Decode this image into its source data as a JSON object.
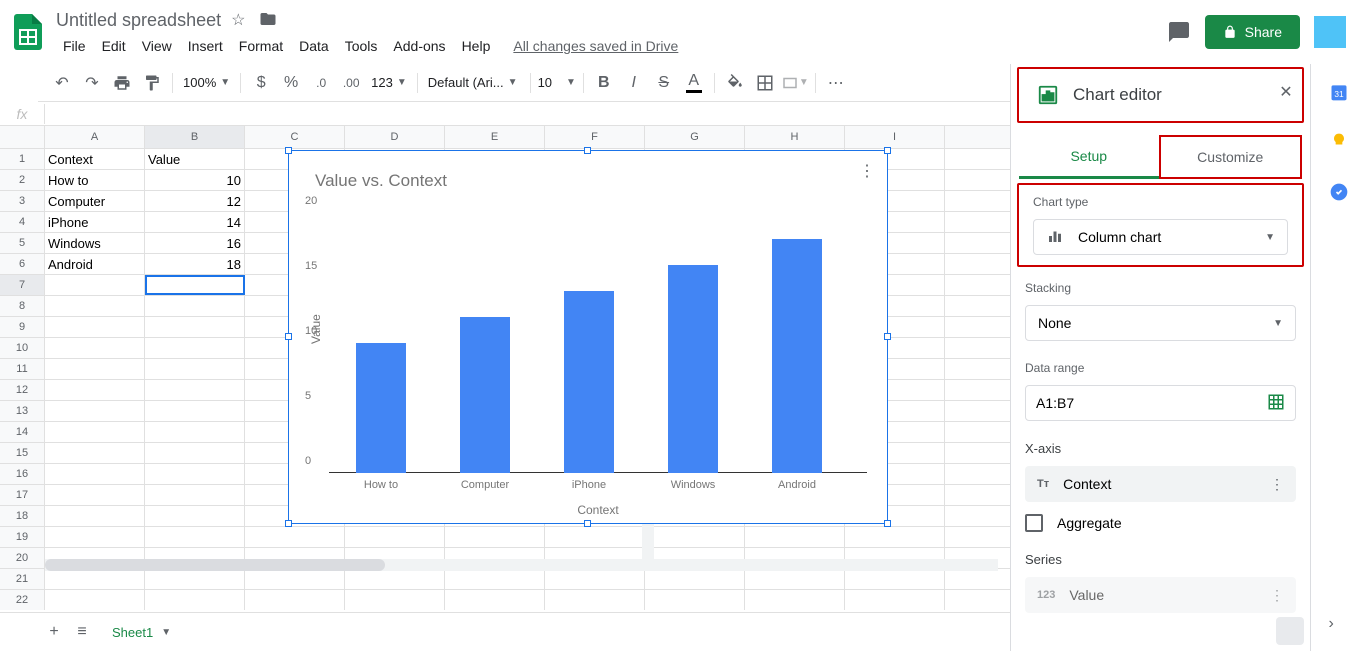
{
  "header": {
    "doc_title": "Untitled spreadsheet",
    "saved_msg": "All changes saved in Drive",
    "share_label": "Share",
    "menu": [
      "File",
      "Edit",
      "View",
      "Insert",
      "Format",
      "Data",
      "Tools",
      "Add-ons",
      "Help"
    ]
  },
  "toolbar": {
    "zoom": "100%",
    "font": "Default (Ari...",
    "size": "10"
  },
  "columns": [
    "A",
    "B",
    "C",
    "D",
    "E",
    "F",
    "G",
    "H",
    "I"
  ],
  "table": {
    "headers": [
      "Context",
      "Value"
    ],
    "rows": [
      {
        "context": "How to",
        "value": 10
      },
      {
        "context": "Computer",
        "value": 12
      },
      {
        "context": "iPhone",
        "value": 14
      },
      {
        "context": "Windows",
        "value": 16
      },
      {
        "context": "Android",
        "value": 18
      }
    ]
  },
  "chart_data": {
    "type": "bar",
    "title": "Value vs. Context",
    "xlabel": "Context",
    "ylabel": "Value",
    "categories": [
      "How to",
      "Computer",
      "iPhone",
      "Windows",
      "Android"
    ],
    "values": [
      10,
      12,
      14,
      16,
      18
    ],
    "ylim": [
      0,
      20
    ],
    "yticks": [
      0,
      5,
      10,
      15,
      20
    ]
  },
  "editor": {
    "title": "Chart editor",
    "tabs": {
      "setup": "Setup",
      "customize": "Customize"
    },
    "chart_type_label": "Chart type",
    "chart_type_value": "Column chart",
    "stacking_label": "Stacking",
    "stacking_value": "None",
    "data_range_label": "Data range",
    "data_range_value": "A1:B7",
    "xaxis_label": "X-axis",
    "xaxis_value": "Context",
    "aggregate_label": "Aggregate",
    "series_label": "Series",
    "series_value": "Value"
  },
  "sheets": {
    "active": "Sheet1"
  }
}
